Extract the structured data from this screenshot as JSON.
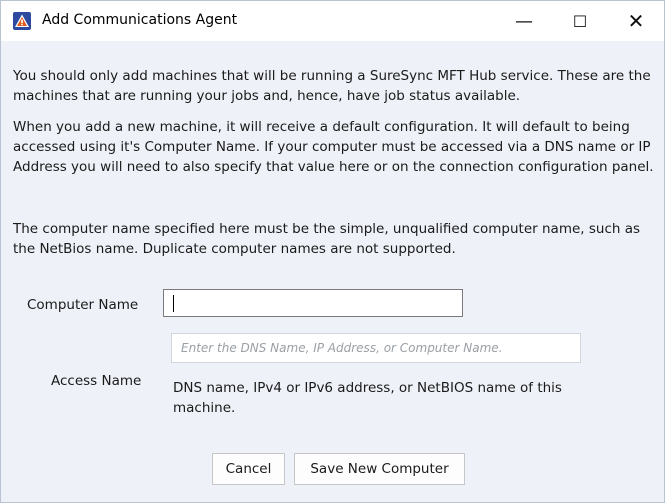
{
  "window": {
    "title": "Add Communications Agent",
    "icon": "warning-triangle-icon",
    "controls": {
      "minimize": "—",
      "maximize": "☐",
      "close": "✕"
    }
  },
  "intro": {
    "paragraph1": "You should only add machines that will be running a SureSync MFT Hub service. These are the machines that are running your jobs and, hence, have job status available.",
    "paragraph2": "When you add a new machine, it will receive a default configuration. It will default to being accessed using it's Computer Name. If your computer must be accessed via a DNS name or IP Address you will need to also specify that value here or on the connection configuration panel.",
    "paragraph3": "The computer name specified here must be the simple, unqualified computer name, such as the NetBios name. Duplicate computer names are not supported."
  },
  "form": {
    "computer_name_label": "Computer Name",
    "computer_name_value": "",
    "access_name_label": "Access Name",
    "access_name_value": "",
    "access_name_placeholder": "Enter the DNS Name, IP Address, or Computer Name.",
    "access_name_help": "DNS name, IPv4 or IPv6 address, or NetBIOS name of this machine."
  },
  "buttons": {
    "cancel": "Cancel",
    "save": "Save New Computer"
  },
  "colors": {
    "client_background": "#eef2f8",
    "warning_icon_fill": "#2b4aa0",
    "warning_icon_accent": "#e05a1a"
  }
}
